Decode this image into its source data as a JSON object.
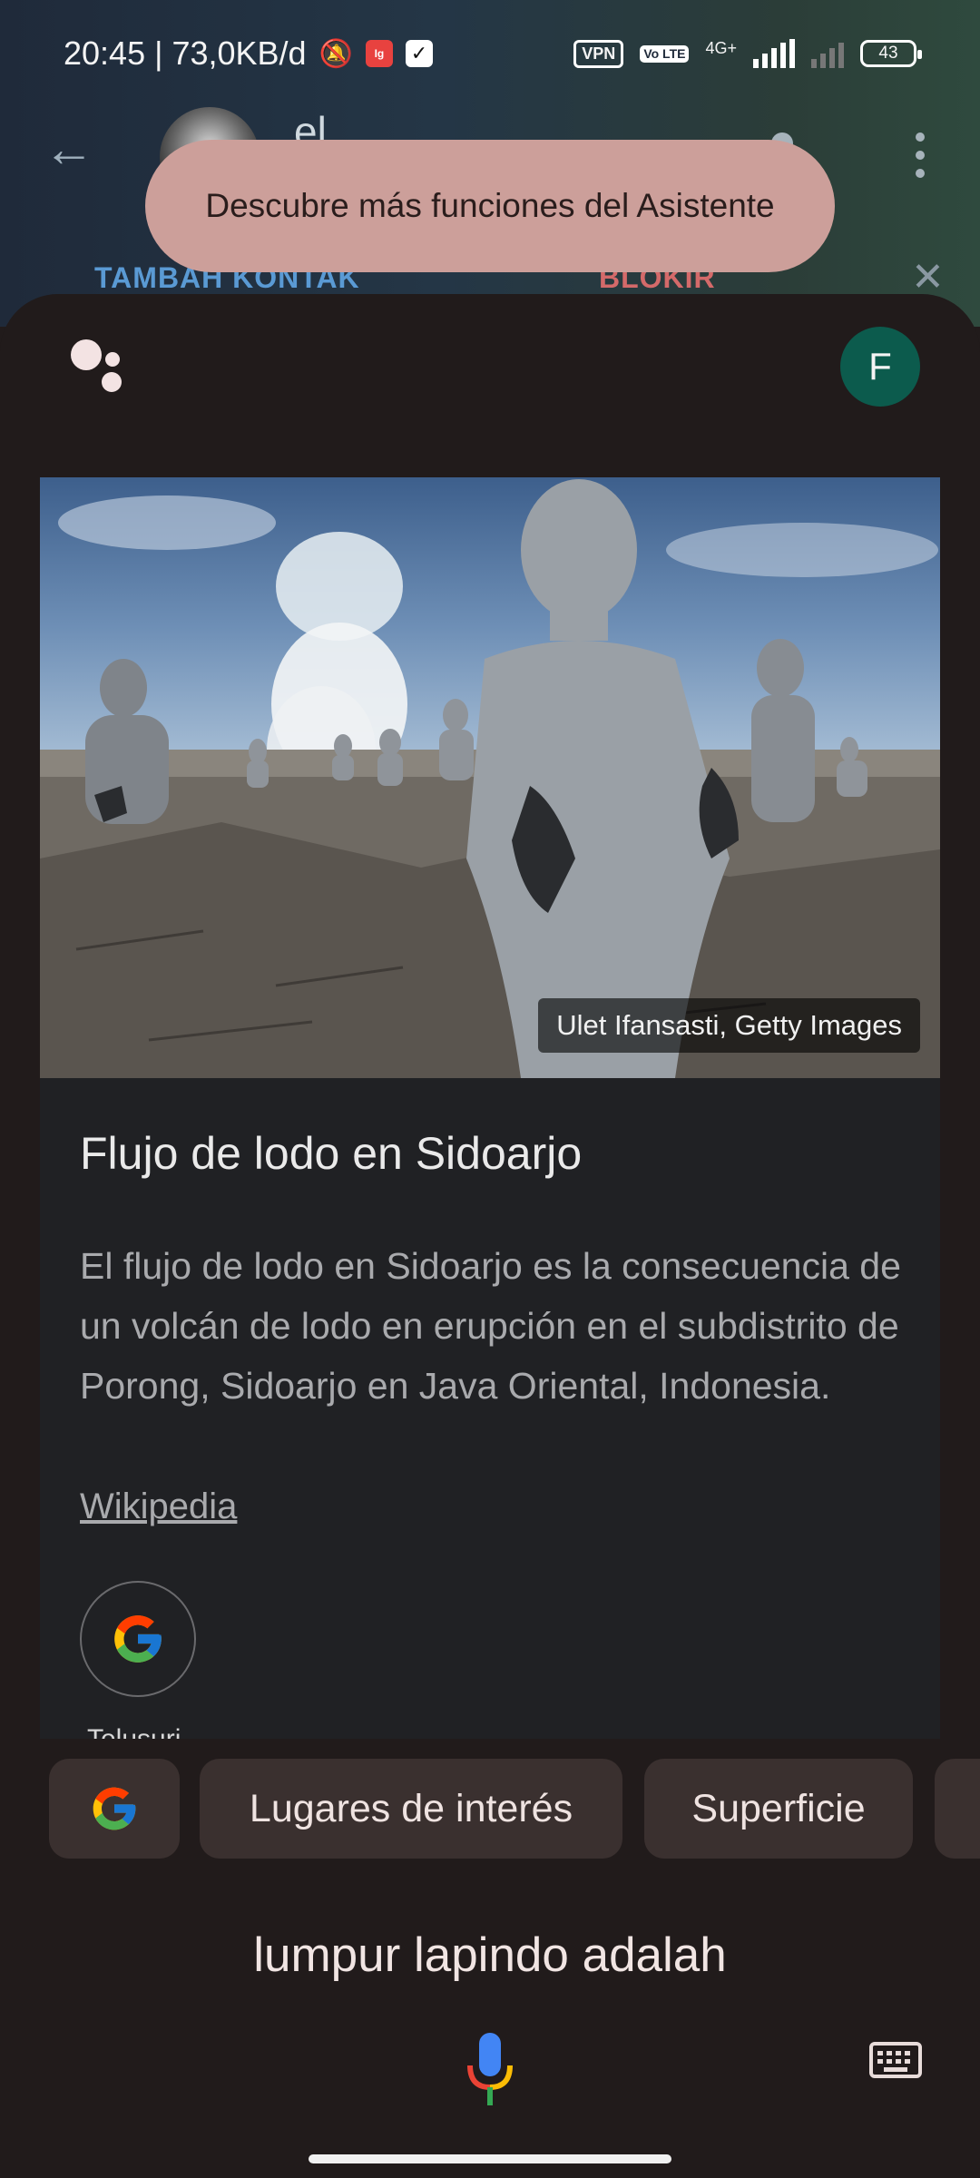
{
  "status_bar": {
    "time_speed": "20:45 | 73,0KB/d",
    "vpn": "VPN",
    "volte": "Vo LTE",
    "network": "4G+",
    "battery": "43"
  },
  "chat_header": {
    "contact_name": "el",
    "add_contact": "TAMBAH KONTAK",
    "block": "BLOKIR"
  },
  "toast": {
    "text": "Descubre más funciones del Asistente"
  },
  "assistant": {
    "profile_initial": "F"
  },
  "card": {
    "image_credit": "Ulet Ifansasti, Getty Images",
    "title": "Flujo de lodo en Sidoarjo",
    "description": "El flujo de lodo en Sidoarjo es la consecuencia de un volcán de lodo en erupción en el subdistrito de Porong, Sidoarjo en Java Oriental, Indonesia.",
    "source": "Wikipedia",
    "action_label": "Telusuri"
  },
  "chips": [
    "Lugares de interés",
    "Superficie"
  ],
  "query": "lumpur lapindo adalah",
  "colors": {
    "toast_bg": "#cc9f9a",
    "avatar_bg": "#0c5b4d",
    "sheet_bg": "#211b1b",
    "card_bg": "#202124",
    "chip_bg": "#3a302f"
  }
}
